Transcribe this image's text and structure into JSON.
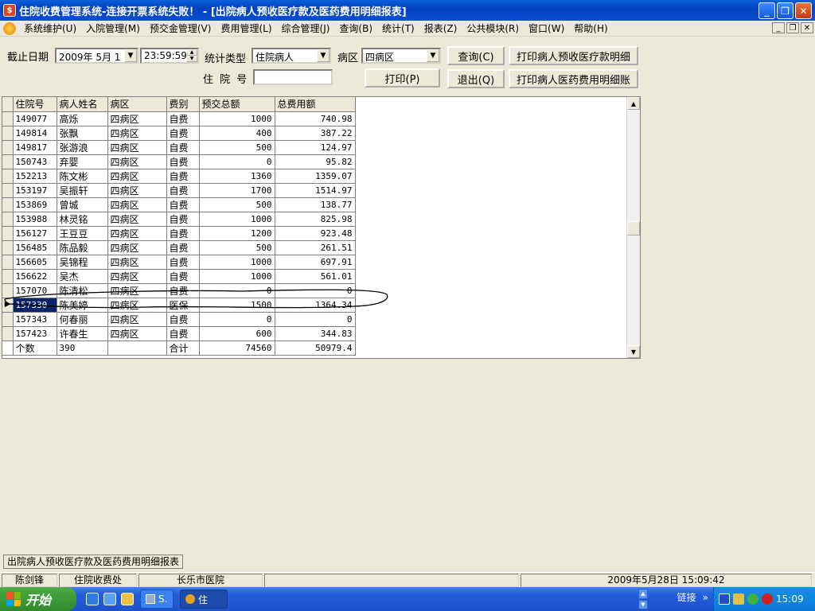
{
  "window": {
    "title": "住院收费管理系统-连接开票系统失败！ - [出院病人预收医疗款及医药费用明细报表]"
  },
  "menu": [
    "系统维护(U)",
    "入院管理(M)",
    "预交金管理(V)",
    "费用管理(L)",
    "综合管理(J)",
    "查询(B)",
    "统计(T)",
    "报表(Z)",
    "公共模块(R)",
    "窗口(W)",
    "帮助(H)"
  ],
  "form": {
    "date_label": "截止日期",
    "date_value": "2009年 5月 1",
    "time_value": "23:59:59",
    "stat_type_label": "统计类型",
    "stat_type_value": "住院病人",
    "ward_label": "病区",
    "ward_value": "四病区",
    "admission_no_label": "住 院 号",
    "admission_no_value": "",
    "query_button": "查询(C)",
    "print_button": "打印(P)",
    "exit_button": "退出(Q)",
    "print_prepay_button": "打印病人预收医疗款明细",
    "print_expense_button": "打印病人医药费用明细账"
  },
  "table": {
    "headers": [
      "住院号",
      "病人姓名",
      "病区",
      "费别",
      "预交总额",
      "总费用额"
    ],
    "rows": [
      [
        "149077",
        "高烁",
        "四病区",
        "自费",
        "1000",
        "740.98"
      ],
      [
        "149814",
        "张飘",
        "四病区",
        "自费",
        "400",
        "387.22"
      ],
      [
        "149817",
        "张游浪",
        "四病区",
        "自费",
        "500",
        "124.97"
      ],
      [
        "150743",
        "弃婴",
        "四病区",
        "自费",
        "0",
        "95.82"
      ],
      [
        "152213",
        "陈文彬",
        "四病区",
        "自费",
        "1360",
        "1359.07"
      ],
      [
        "153197",
        "吴振轩",
        "四病区",
        "自费",
        "1700",
        "1514.97"
      ],
      [
        "153869",
        "曾城",
        "四病区",
        "自费",
        "500",
        "138.77"
      ],
      [
        "153988",
        "林灵铭",
        "四病区",
        "自费",
        "1000",
        "825.98"
      ],
      [
        "156127",
        "王豆豆",
        "四病区",
        "自费",
        "1200",
        "923.48"
      ],
      [
        "156485",
        "陈品毅",
        "四病区",
        "自费",
        "500",
        "261.51"
      ],
      [
        "156605",
        "吴锦程",
        "四病区",
        "自费",
        "1000",
        "697.91"
      ],
      [
        "156622",
        "吴杰",
        "四病区",
        "自费",
        "1000",
        "561.01"
      ],
      [
        "157070",
        "陈清松",
        "四病区",
        "自费",
        "0",
        "0"
      ],
      [
        "157330",
        "陈美婷",
        "四病区",
        "医保",
        "1500",
        "1364.34"
      ],
      [
        "157343",
        "何春丽",
        "四病区",
        "自费",
        "0",
        "0"
      ],
      [
        "157423",
        "许春生",
        "四病区",
        "自费",
        "600",
        "344.83"
      ]
    ],
    "selected_index": 13,
    "footer": [
      "个数",
      "390",
      "",
      "合计",
      "74560",
      "50979.4"
    ]
  },
  "report_tab": "出院病人预收医疗款及医药费用明细报表",
  "status": {
    "user": "陈剑锋",
    "dept": "住院收费处",
    "hospital": "长乐市医院",
    "datetime": "2009年5月28日 15:09:42"
  },
  "taskbar": {
    "start": "开始",
    "task1": "S.",
    "task2": "住",
    "links": "链接",
    "links_more": "»",
    "clock": "15:09"
  },
  "colors": {
    "title_blue": "#0342c2",
    "selection": "#0a246a",
    "start_green": "#2f8a2b"
  }
}
